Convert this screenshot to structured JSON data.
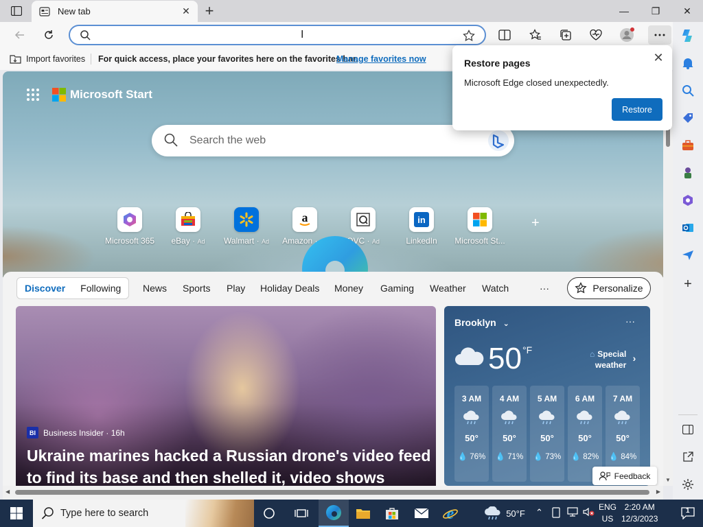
{
  "browser": {
    "tab_title": "New tab",
    "window_controls": {
      "minimize": "—",
      "restore": "❐",
      "close": "✕"
    }
  },
  "favorites_bar": {
    "import_label": "Import favorites",
    "hint": "For quick access, place your favorites here on the favorites bar.",
    "manage_link": "Manage favorites now"
  },
  "popup": {
    "title": "Restore pages",
    "message": "Microsoft Edge closed unexpectedly.",
    "restore_button": "Restore"
  },
  "start_page": {
    "brand": "Microsoft Start",
    "search_placeholder": "Search the web",
    "quick_links": [
      {
        "label": "Microsoft 365",
        "ad": ""
      },
      {
        "label": "eBay",
        "ad": "Ad"
      },
      {
        "label": "Walmart",
        "ad": "Ad"
      },
      {
        "label": "Amazon",
        "ad": "Ad"
      },
      {
        "label": "QVC",
        "ad": "Ad"
      },
      {
        "label": "LinkedIn",
        "ad": ""
      },
      {
        "label": "Microsoft St...",
        "ad": ""
      }
    ],
    "feed_tabs": [
      "Discover",
      "Following"
    ],
    "nav_items": [
      "News",
      "Sports",
      "Play",
      "Holiday Deals",
      "Money",
      "Gaming",
      "Weather",
      "Watch",
      "···"
    ],
    "personalize_label": "Personalize",
    "news": {
      "source_badge": "BI",
      "source": "Business Insider · 16h",
      "title": "Ukraine marines hacked a Russian drone's video feed to find its base and then shelled it, video shows"
    },
    "weather": {
      "city": "Brooklyn",
      "more": "···",
      "temp": "50",
      "unit": "°F",
      "special_line1": "Special",
      "special_line2": "weather",
      "hours": [
        {
          "time": "3 AM",
          "temp": "50°",
          "precip": "76%"
        },
        {
          "time": "4 AM",
          "temp": "50°",
          "precip": "71%"
        },
        {
          "time": "5 AM",
          "temp": "50°",
          "precip": "73%"
        },
        {
          "time": "6 AM",
          "temp": "50°",
          "precip": "82%"
        },
        {
          "time": "7 AM",
          "temp": "50°",
          "precip": "84%"
        }
      ]
    },
    "feedback_label": "Feedback"
  },
  "taskbar": {
    "search_placeholder": "Type here to search",
    "weather_temp": "50°F",
    "lang_line1": "ENG",
    "lang_line2": "US",
    "time": "2:20 AM",
    "date": "12/3/2023",
    "notification_count": "1"
  },
  "colors": {
    "accent": "#0f6cbd",
    "taskbar": "#1c2f4a"
  }
}
